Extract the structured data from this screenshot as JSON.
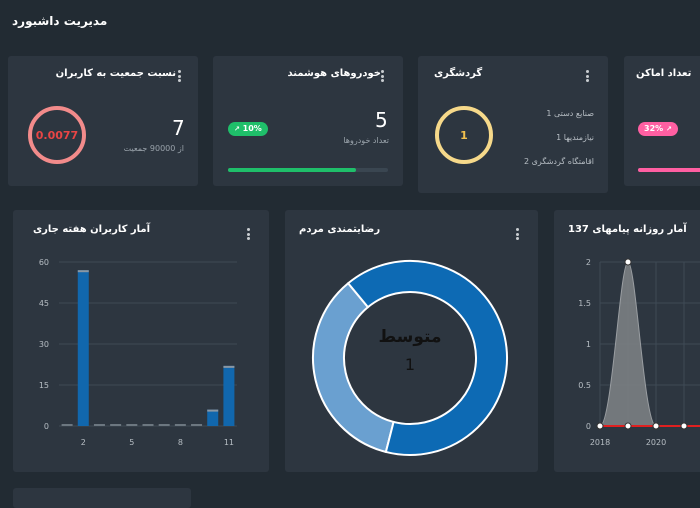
{
  "header": {
    "title": "مدیریت داشبورد"
  },
  "cards": {
    "population": {
      "title": "نسبت جمعیت به کاربران",
      "percent_label": "0.0077",
      "count": "7",
      "subtitle": "از 90000 جمعیت"
    },
    "cars": {
      "title": "خودروهای هوشمند",
      "count": "5",
      "subtitle": "تعداد خودروها",
      "badge": "10%",
      "progress": 0.8,
      "progress_color": "#1fbf6a"
    },
    "tourism": {
      "title": "گردشگری",
      "ring_value": "1",
      "items": [
        "صنایع دستی 1",
        "نیازمندیها 1",
        "اقامتگاه گردشگری 2"
      ]
    },
    "places": {
      "title": "تعداد اماکن",
      "badge": "32%",
      "badge_color": "#ff5fa2"
    }
  },
  "colors": {
    "green": "#1fbf6a",
    "pink": "#ff5fa2",
    "red_ring": "#f28b8b",
    "yellow_ring": "#f6d98a",
    "blue": "#0d6ab4",
    "light_blue": "#6aa0d0"
  },
  "weekly_chart": {
    "title": "آمار کاربران هفته جاری",
    "chart_data": {
      "type": "bar",
      "categories": [
        "1",
        "2",
        "3",
        "4",
        "5",
        "6",
        "7",
        "8",
        "9",
        "10",
        "11"
      ],
      "values": [
        0,
        57,
        0,
        0,
        0,
        0,
        0,
        0,
        0,
        6,
        22
      ],
      "ylim": [
        0,
        60
      ],
      "yticks": [
        "0",
        "15",
        "30",
        "45",
        "60"
      ],
      "xticks": [
        "2",
        "5",
        "8",
        "11"
      ]
    }
  },
  "satisfaction": {
    "title": "رضایتمندی مردم",
    "center_label": "متوسط",
    "center_value": "1",
    "chart_data": {
      "type": "pie",
      "slices": [
        {
          "label": "متوسط",
          "value": 65
        },
        {
          "label": "",
          "value": 35
        }
      ]
    }
  },
  "messages": {
    "title": "آمار روزانه پیامهای 137",
    "chart_data": {
      "type": "area",
      "x": [
        2018,
        2019,
        2020,
        2021
      ],
      "series": [
        {
          "values": [
            0,
            2,
            0,
            0
          ]
        },
        {
          "values": [
            0,
            0,
            0,
            0
          ]
        }
      ],
      "ylim": [
        0,
        2
      ],
      "yticks": [
        "0",
        "0.5",
        "1",
        "1.5",
        "2"
      ],
      "xticks": [
        "2018",
        "2020"
      ]
    }
  }
}
